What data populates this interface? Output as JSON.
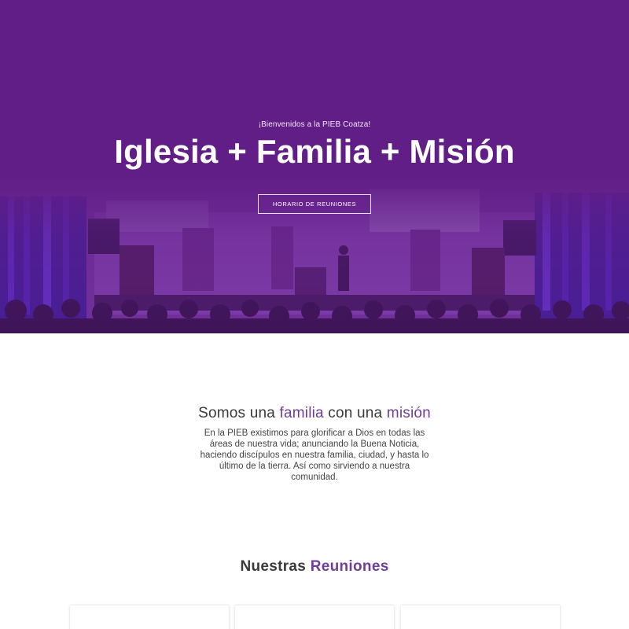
{
  "hero": {
    "kicker": "¡Bienvenidos a la PIEB Coatza!",
    "title": "Iglesia + Familia + Misión",
    "button_label": "HORARIO DE REUNIONES",
    "overlay_color": "#621e87"
  },
  "intro": {
    "heading_prefix": "Somos una ",
    "heading_accent1": "familia",
    "heading_middle": " con una ",
    "heading_accent2": "misión",
    "body": "En la PIEB existimos para glorificar a Dios en todas las áreas de nuestra vida; anunciando la Buena Noticia, haciendo discípulos en nuestra familia, ciudad, y hasta lo último de la tierra. Así como sirviendo a nuestra comunidad.",
    "accent_color": "#6f3d9a"
  },
  "meetings": {
    "heading_prefix": "Nuestras ",
    "heading_accent": "Reuniones",
    "card_count": 3
  }
}
